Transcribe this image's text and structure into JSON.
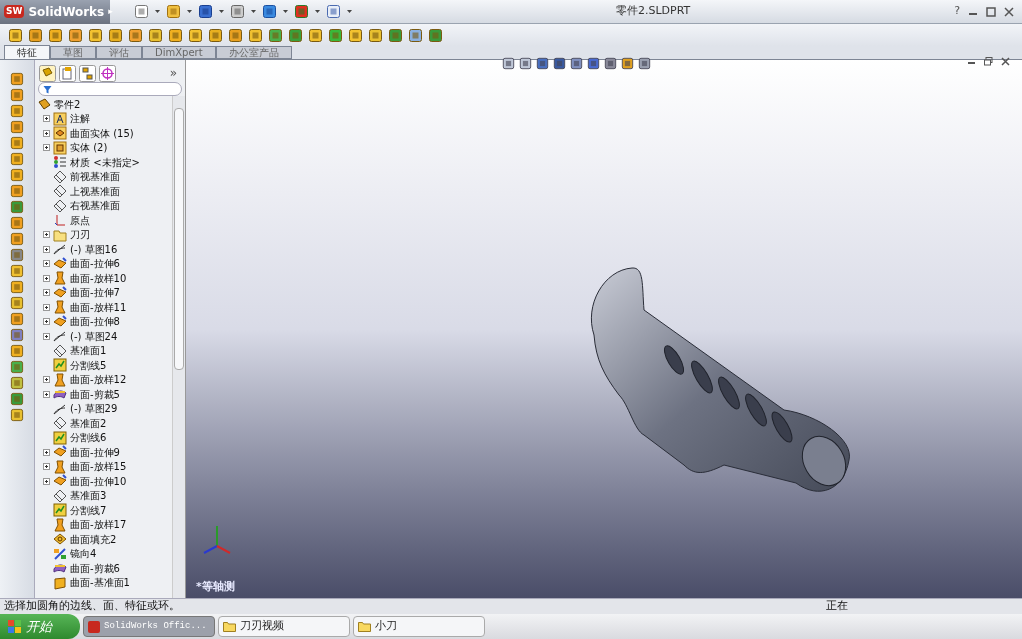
{
  "app": {
    "logo_badge": "SW",
    "logo": "SolidWorks",
    "menu_arrow": "▸"
  },
  "window": {
    "title": "零件2.SLDPRT",
    "help": "?"
  },
  "command_tabs": [
    {
      "label": "特征",
      "selected": true
    },
    {
      "label": "草图",
      "selected": false
    },
    {
      "label": "评估",
      "selected": false
    },
    {
      "label": "DimXpert",
      "selected": false
    },
    {
      "label": "办公室产品",
      "selected": false
    }
  ],
  "panel": {
    "more": "»"
  },
  "tree": {
    "label": "零件2",
    "children": [
      {
        "label": "注解",
        "kind": "annotations",
        "expandable": true
      },
      {
        "label": "曲面实体 (15)",
        "kind": "surface-bodies",
        "expandable": true
      },
      {
        "label": "实体 (2)",
        "kind": "solid-bodies",
        "expandable": true
      },
      {
        "label": "材质 <未指定>",
        "kind": "material",
        "expandable": false
      },
      {
        "label": "前视基准面",
        "kind": "plane",
        "expandable": false
      },
      {
        "label": "上视基准面",
        "kind": "plane",
        "expandable": false
      },
      {
        "label": "右视基准面",
        "kind": "plane",
        "expandable": false
      },
      {
        "label": "原点",
        "kind": "origin",
        "expandable": false
      },
      {
        "label": "刀刃",
        "kind": "folder",
        "expandable": true
      },
      {
        "label": "(-) 草图16",
        "kind": "sketch",
        "expandable": true
      },
      {
        "label": "曲面-拉伸6",
        "kind": "extrude",
        "expandable": true
      },
      {
        "label": "曲面-放样10",
        "kind": "loft",
        "expandable": true
      },
      {
        "label": "曲面-拉伸7",
        "kind": "extrude",
        "expandable": true
      },
      {
        "label": "曲面-放样11",
        "kind": "loft",
        "expandable": true
      },
      {
        "label": "曲面-拉伸8",
        "kind": "extrude",
        "expandable": true
      },
      {
        "label": "(-) 草图24",
        "kind": "sketch",
        "expandable": true
      },
      {
        "label": "基准面1",
        "kind": "plane",
        "expandable": false
      },
      {
        "label": "分割线5",
        "kind": "split",
        "expandable": false
      },
      {
        "label": "曲面-放样12",
        "kind": "loft",
        "expandable": true
      },
      {
        "label": "曲面-剪裁5",
        "kind": "trim",
        "expandable": true
      },
      {
        "label": "(-) 草图29",
        "kind": "sketch",
        "expandable": false
      },
      {
        "label": "基准面2",
        "kind": "plane",
        "expandable": false
      },
      {
        "label": "分割线6",
        "kind": "split",
        "expandable": false
      },
      {
        "label": "曲面-拉伸9",
        "kind": "extrude",
        "expandable": true
      },
      {
        "label": "曲面-放样15",
        "kind": "loft",
        "expandable": true
      },
      {
        "label": "曲面-拉伸10",
        "kind": "extrude",
        "expandable": true
      },
      {
        "label": "基准面3",
        "kind": "plane",
        "expandable": false
      },
      {
        "label": "分割线7",
        "kind": "split",
        "expandable": false
      },
      {
        "label": "曲面-放样17",
        "kind": "loft",
        "expandable": false
      },
      {
        "label": "曲面填充2",
        "kind": "fill",
        "expandable": false
      },
      {
        "label": "镜向4",
        "kind": "mirror",
        "expandable": false
      },
      {
        "label": "曲面-剪裁6",
        "kind": "trim",
        "expandable": false
      },
      {
        "label": "曲面-基准面1",
        "kind": "planar",
        "expandable": false
      }
    ]
  },
  "viewport": {
    "view_label": "*等轴测"
  },
  "status_bar": {
    "message": "选择加圆角的边线、面、特征或环。",
    "state": "正在"
  },
  "taskbar": {
    "start": "开始",
    "windows": [
      {
        "label": "SolidWorks Offic...",
        "kind": "app",
        "selected": true
      },
      {
        "label": "刀刃视频",
        "kind": "folder",
        "selected": false
      },
      {
        "label": "小刀",
        "kind": "folder",
        "selected": false
      }
    ]
  }
}
